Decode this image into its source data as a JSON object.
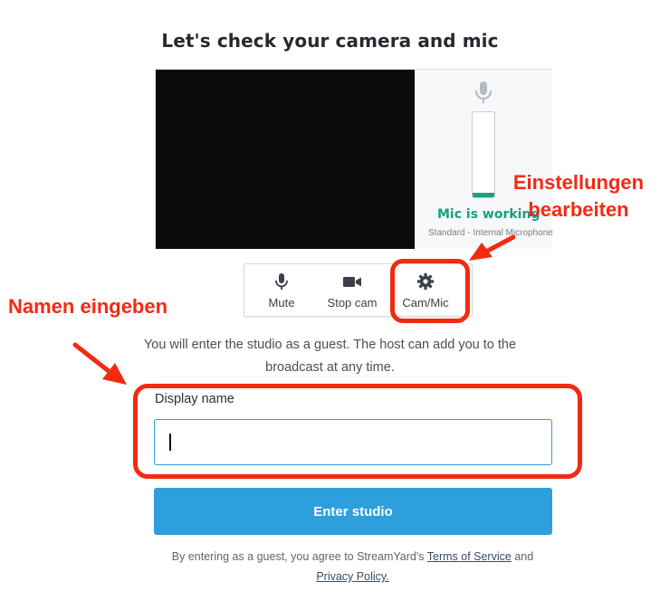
{
  "title": "Let's check your camera and mic",
  "mic_panel": {
    "status": "Mic is working",
    "device": "Standard - Internal Microphone",
    "level_fraction": 0.05,
    "level_color": "#1aa37f"
  },
  "controls": [
    {
      "label": "Mute",
      "icon": "microphone-icon"
    },
    {
      "label": "Stop cam",
      "icon": "video-camera-icon"
    },
    {
      "label": "Cam/Mic",
      "icon": "gear-icon"
    }
  ],
  "guest_note": "You will enter the studio as a guest. The host can add you to the broadcast at any time.",
  "display_name": {
    "label": "Display name",
    "value": "",
    "placeholder": ""
  },
  "enter_button": "Enter studio",
  "legal": {
    "prefix": "By entering as a guest, you agree to StreamYard's",
    "terms_link": "Terms of Service",
    "middle": "and",
    "privacy_link": "Privacy Policy."
  },
  "annotations": {
    "settings_line1": "Einstellungen",
    "settings_line2": "bearbeiten",
    "name_hint": "Namen eingeben",
    "color": "#f32a12"
  },
  "colors": {
    "accent": "#2d9fdd",
    "success": "#16a085"
  }
}
